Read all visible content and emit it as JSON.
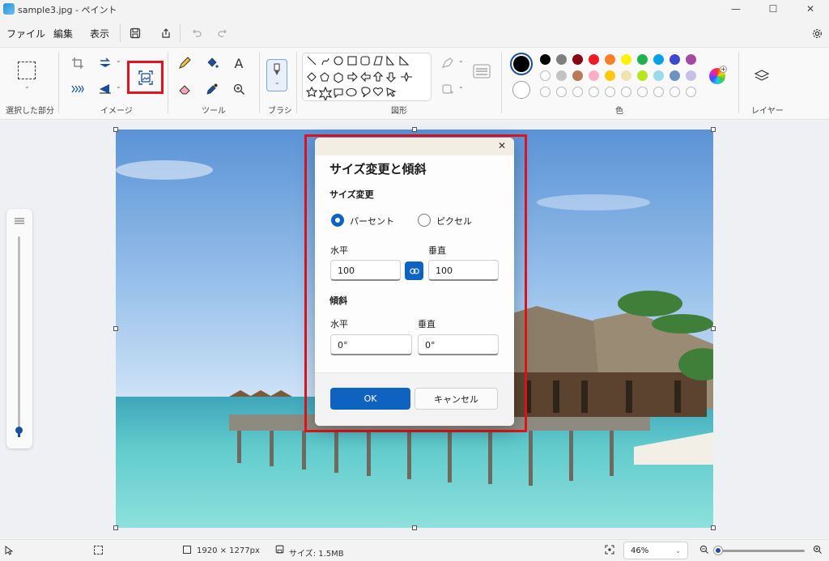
{
  "window": {
    "title": "sample3.jpg - ペイント",
    "minimize_glyph": "—",
    "maximize_glyph": "☐",
    "close_glyph": "✕"
  },
  "menu": {
    "items": [
      "ファイル",
      "編集",
      "表示"
    ]
  },
  "ribbon": {
    "groups": {
      "selection": "選択した部分",
      "image": "イメージ",
      "tools": "ツール",
      "brush": "ブラシ",
      "shapes": "図形",
      "colors": "色",
      "layers": "レイヤー"
    },
    "text_tool_glyph": "A",
    "primary_color": "#000000",
    "secondary_color": "#ffffff",
    "palette_row1": [
      "#000000",
      "#7f7f7f",
      "#880015",
      "#ed1c24",
      "#ff7f27",
      "#fff200",
      "#22b14c",
      "#00a2e8",
      "#3f48cc",
      "#a349a4"
    ],
    "palette_row2": [
      "#ffffff",
      "#c3c3c3",
      "#b97a57",
      "#ffaec9",
      "#ffc90e",
      "#efe4b0",
      "#b5e61d",
      "#99d9ea",
      "#7092be",
      "#c8bfe7"
    ]
  },
  "dialog": {
    "title": "サイズ変更と傾斜",
    "close_glyph": "✕",
    "resize_section": "サイズ変更",
    "option_percent": "パーセント",
    "option_pixel": "ピクセル",
    "horizontal_label": "水平",
    "vertical_label": "垂直",
    "horizontal_value": "100",
    "vertical_value": "100",
    "skew_section": "傾斜",
    "skew_horizontal_label": "水平",
    "skew_vertical_label": "垂直",
    "skew_horizontal_value": "0°",
    "skew_vertical_value": "0°",
    "ok_label": "OK",
    "cancel_label": "キャンセル"
  },
  "status": {
    "dimensions": "1920 × 1277px",
    "size": "サイズ: 1.5MB",
    "zoom": "46%",
    "zoom_slider_fraction": 0.03
  }
}
